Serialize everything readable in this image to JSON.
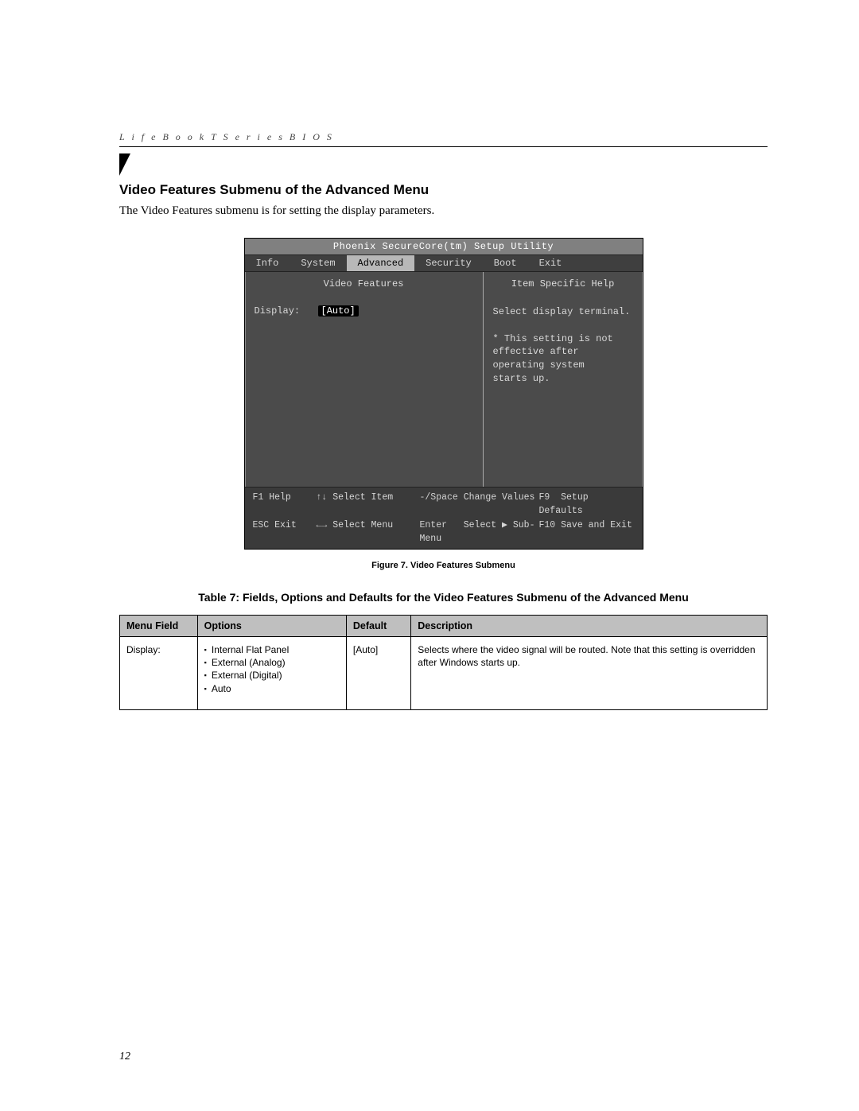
{
  "running_head": "L i f e B o o k   T   S e r i e s   B I O S",
  "section_title": "Video Features Submenu of the Advanced Menu",
  "lead_text": "The Video Features submenu is for setting the display parameters.",
  "bios": {
    "utility_title": "Phoenix SecureCore(tm) Setup Utility",
    "tabs": [
      "Info",
      "System",
      "Advanced",
      "Security",
      "Boot",
      "Exit"
    ],
    "active_tab_index": 2,
    "left_panel_title": "Video Features",
    "fields": [
      {
        "label": "Display:",
        "value": "[Auto]"
      }
    ],
    "help_title": "Item Specific Help",
    "help_body": "Select display terminal.\n\n* This setting is not\neffective after\noperating system\nstarts up.",
    "footer": {
      "row1": [
        {
          "key": "F1",
          "label": "Help"
        },
        {
          "key": "↑↓",
          "label": "Select Item"
        },
        {
          "key": "-/Space",
          "label": "Change Values"
        },
        {
          "key": "F9",
          "label": "Setup Defaults"
        }
      ],
      "row2": [
        {
          "key": "ESC",
          "label": "Exit"
        },
        {
          "key": "←→",
          "label": "Select Menu"
        },
        {
          "key": "Enter",
          "label": "Select ▶ Sub-Menu"
        },
        {
          "key": "F10",
          "label": "Save and Exit"
        }
      ]
    }
  },
  "figure_caption": "Figure 7.  Video Features Submenu",
  "table_title": "Table 7: Fields, Options and Defaults for the Video Features Submenu of the Advanced Menu",
  "table": {
    "headers": [
      "Menu Field",
      "Options",
      "Default",
      "Description"
    ],
    "rows": [
      {
        "menu_field": "Display:",
        "options": [
          "Internal Flat Panel",
          "External (Analog)",
          "External (Digital)",
          "Auto"
        ],
        "default": "[Auto]",
        "description": "Selects where the video signal will be routed. Note that this setting is overridden after Windows starts up."
      }
    ]
  },
  "page_number": "12"
}
